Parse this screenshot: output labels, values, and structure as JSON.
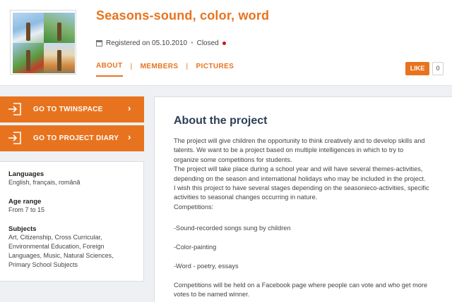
{
  "header": {
    "title": "Seasons-sound, color, word",
    "registered": "Registered on 05.10.2010",
    "status": "Closed",
    "tabs": [
      "ABOUT",
      "MEMBERS",
      "PICTURES"
    ],
    "like_label": "LIKE",
    "like_count": "0"
  },
  "sidebar": {
    "buttons": [
      {
        "label": "GO TO TWINSPACE",
        "icon": "enter-icon"
      },
      {
        "label": "GO TO PROJECT DIARY",
        "icon": "enter-icon"
      }
    ],
    "languages_heading": "Languages",
    "languages": "English, français, română",
    "age_heading": "Age range",
    "age": "From 7 to 15",
    "subjects_heading": "Subjects",
    "subjects": [
      "Art, Citizenship, Cross Curricular,",
      "Environmental Education, Foreign",
      "Languages, Music, Natural Sciences,",
      "Primary School Subjects"
    ]
  },
  "main": {
    "heading": "About the project",
    "paragraphs": [
      [
        "The project will give children the opportunity to think creatively and to develop skills and",
        "talents. We want to be a project based on multiple intelligences in which to try to",
        "organize some competitions for students.",
        "The project will take place during a school year and will have several themes-activities,",
        "depending on the season and international holidays who may be included in the project.",
        "I wish this project to have several stages depending on the seasonieco-activities, specific",
        "activities to seasonal changes occurring in nature.",
        "Competitions:"
      ],
      [
        "-Sound-recorded songs sung by children"
      ],
      [
        "-Color-painting"
      ],
      [
        "-Word - poetry, essays"
      ],
      [
        "Competitions will be held on a Facebook page where people can vote and who get more",
        "votes to be named winner."
      ]
    ]
  },
  "colors": {
    "accent": "#e8731e",
    "heading": "#2c3e55",
    "status_dot": "#d0121b"
  }
}
